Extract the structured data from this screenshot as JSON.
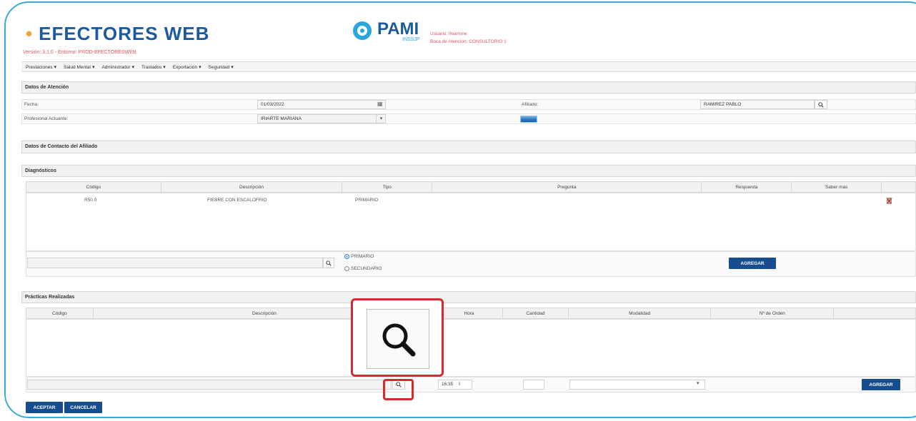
{
  "header": {
    "brand": "EFECTORES WEB",
    "version": "Versión: 3.1.0 - Entorno: PROD-EFECTORESWEB",
    "pami": "PAMI",
    "inssjp": "INSSJP",
    "user": "Usuario: lmarrone",
    "boca": "Boca de Atencion: CONSULTORIO 1"
  },
  "menu": [
    "Prestaciones",
    "Salud Mental",
    "Administrador",
    "Traslados",
    "Exportación",
    "Seguridad"
  ],
  "atencion": {
    "title": "Datos de Atención",
    "fecha_label": "Fecha:",
    "fecha_value": "01/03/2022",
    "afiliado_label": "Afiliado:",
    "afiliado_value": "RAMIREZ PABLO",
    "profesional_label": "Profesional Actuante:",
    "profesional_value": "IRIARTE MARIANA"
  },
  "contacto": {
    "title": "Datos de Contacto del Afiliado"
  },
  "diagnosticos": {
    "title": "Diagnósticos",
    "columns": [
      "Código",
      "Descripción",
      "Tipo",
      "Pregunta",
      "Respuesta",
      "Saber más"
    ],
    "rows": [
      {
        "codigo": "R50.0",
        "descripcion": "FIEBRE CON ESCALOFRIO",
        "tipo": "PRIMARIO"
      }
    ],
    "radio_primario": "PRIMARIO",
    "radio_secundario": "SECUNDARIO",
    "agregar": "AGREGAR"
  },
  "practicas": {
    "title": "Prácticas Realizadas",
    "columns": [
      "Código",
      "Descripción",
      "Hora",
      "Cantidad",
      "Modalidad",
      "Nº de Orden"
    ],
    "hora_value": "16:35",
    "agregar": "AGREGAR"
  },
  "footer": {
    "aceptar": "ACEPTAR",
    "cancelar": "CANCELAR"
  },
  "colors": {
    "brand": "#1b5aa0",
    "accent": "#f2a23a",
    "button": "#164d8f",
    "highlight": "#d32c2c",
    "frame": "#3aaad6"
  }
}
